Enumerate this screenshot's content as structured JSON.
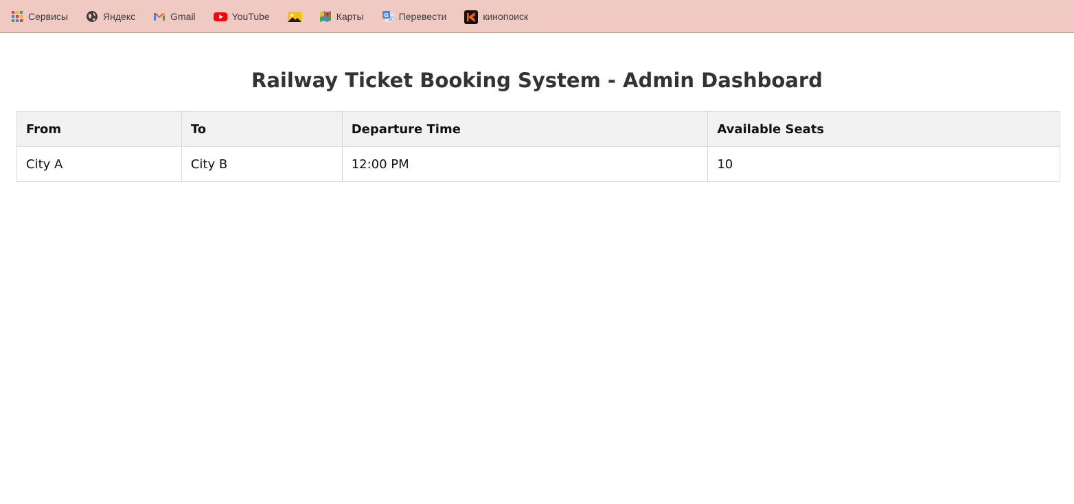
{
  "bookmarks": [
    {
      "label": "Сервисы",
      "icon": "apps-grid-icon"
    },
    {
      "label": "Яндекс",
      "icon": "globe-icon"
    },
    {
      "label": "Gmail",
      "icon": "gmail-icon"
    },
    {
      "label": "YouTube",
      "icon": "youtube-icon"
    },
    {
      "label": "",
      "icon": "image-icon"
    },
    {
      "label": "Карты",
      "icon": "maps-icon"
    },
    {
      "label": "Перевести",
      "icon": "translate-icon"
    },
    {
      "label": "кинопоиск",
      "icon": "kinopoisk-icon"
    }
  ],
  "colors": {
    "bookmarks_bar_bg": "#f0c9c3",
    "title_color": "#333333",
    "table_header_bg": "#f2f2f2",
    "table_border": "#d9d9d9"
  },
  "page": {
    "title": "Railway Ticket Booking System - Admin Dashboard"
  },
  "table": {
    "headers": [
      "From",
      "To",
      "Departure Time",
      "Available Seats"
    ],
    "rows": [
      [
        "City A",
        "City B",
        "12:00 PM",
        "10"
      ]
    ]
  }
}
